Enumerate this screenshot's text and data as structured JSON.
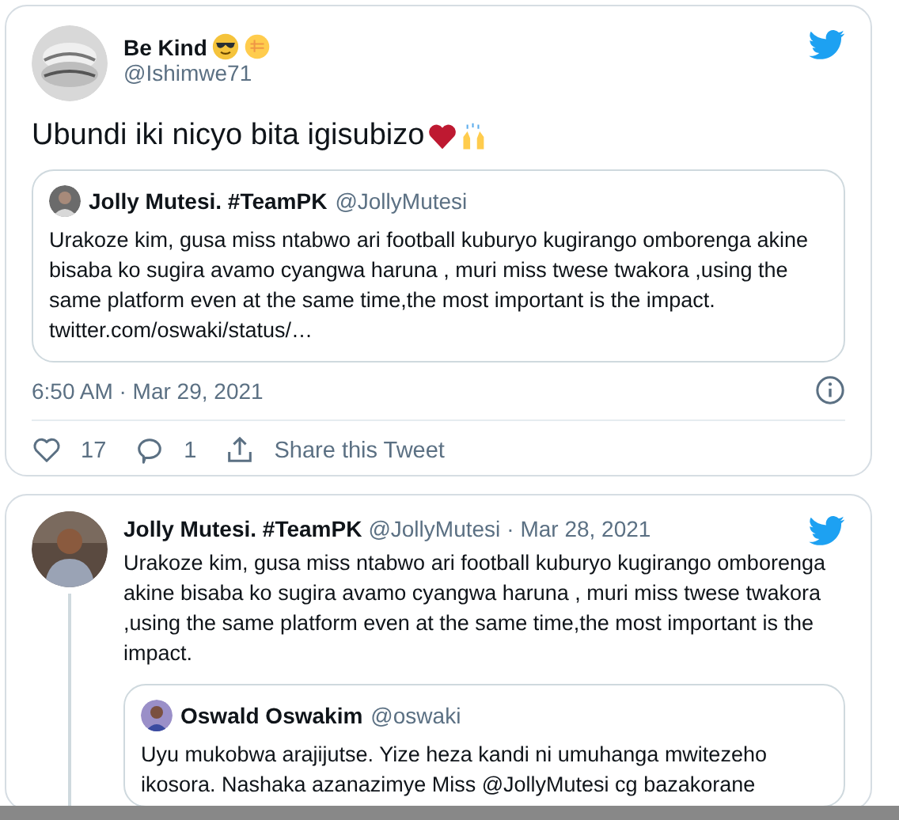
{
  "tweets": [
    {
      "name": "Be Kind",
      "handle": "@Ishimwe71",
      "text": "Ubundi iki nicyo bita igisubizo",
      "quoted": {
        "name": "Jolly Mutesi. #TeamPK",
        "handle": "@JollyMutesi",
        "text": "Urakoze kim, gusa miss ntabwo ari football kuburyo kugirango omborenga akine bisaba ko sugira avamo cyangwa haruna , muri miss twese twakora ,using the same platform even at the same time,the most important is the impact. twitter.com/oswaki/status/…"
      },
      "timestamp": "6:50 AM · Mar 29, 2021",
      "likes": "17",
      "replies": "1",
      "share": "Share this Tweet"
    },
    {
      "name": "Jolly Mutesi. #TeamPK",
      "handle": "@JollyMutesi",
      "date": "· Mar 28, 2021",
      "text": "Urakoze kim, gusa miss ntabwo ari football kuburyo kugirango omborenga akine bisaba ko sugira avamo cyangwa haruna , muri miss twese twakora ,using the same platform even at the same time,the most important is the impact.",
      "quoted": {
        "name": "Oswald Oswakim",
        "handle": "@oswaki",
        "text": "Uyu mukobwa arajijutse. Yize heza kandi ni umuhanga mwitezeho ikosora. Nashaka azanazimye Miss @JollyMutesi cg bazakorane"
      }
    }
  ]
}
